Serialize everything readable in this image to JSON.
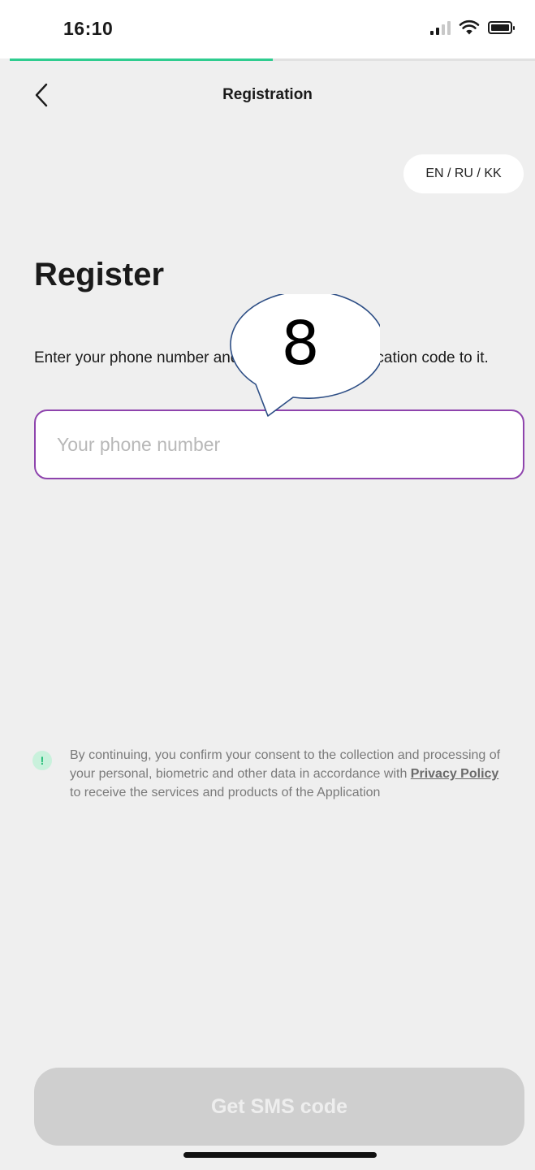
{
  "status_bar": {
    "time": "16:10",
    "signal_icon": "cellular-signal-icon",
    "wifi_icon": "wifi-icon",
    "battery_icon": "battery-icon"
  },
  "progress": {
    "fraction": 0.5,
    "color": "#2ecc8f"
  },
  "header": {
    "back_icon": "chevron-left-icon",
    "title": "Registration"
  },
  "language_switch": {
    "label": "EN / RU / KK"
  },
  "main": {
    "heading": "Register",
    "instructions": "Enter your phone number and we will send a verification code to it.",
    "phone_input": {
      "value": "",
      "placeholder": "Your phone number",
      "border_color": "#8e44ad"
    }
  },
  "annotation": {
    "label": "8"
  },
  "consent": {
    "icon": "info-icon",
    "text_before": "By continuing, you confirm your consent to the collection and processing of your personal, biometric and other data in accordance with ",
    "link_text": "Privacy Policy",
    "text_after": " to receive the services and products of the Application"
  },
  "footer": {
    "button_label": "Get SMS code"
  }
}
